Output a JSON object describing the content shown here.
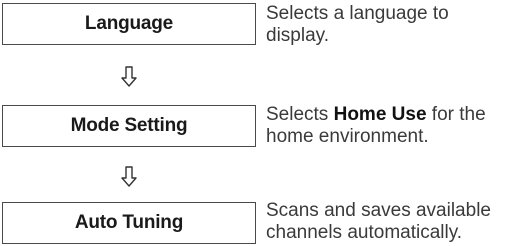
{
  "steps": [
    {
      "label": "Language",
      "desc_before": "Selects a language to display.",
      "desc_highlight": "",
      "desc_after": ""
    },
    {
      "label": "Mode Setting",
      "desc_before": "Selects ",
      "desc_highlight": "Home Use",
      "desc_after": " for the home environment."
    },
    {
      "label": "Auto Tuning",
      "desc_before": "Scans and saves available channels automatically.",
      "desc_highlight": "",
      "desc_after": ""
    }
  ],
  "arrow_icon": "down-arrow-icon",
  "colors": {
    "border": "#4a4a4a",
    "text": "#1a1a1a",
    "description": "#3a3a3a"
  }
}
